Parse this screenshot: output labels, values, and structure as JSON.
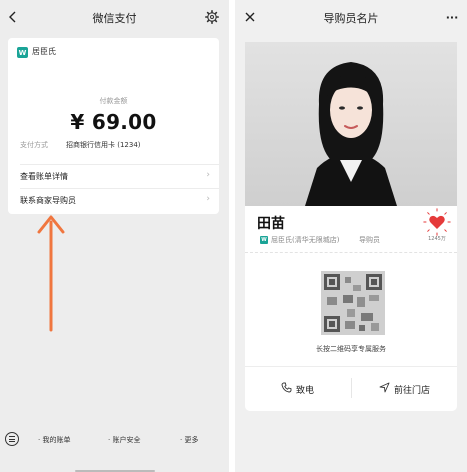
{
  "left": {
    "title": "微信支付",
    "merchant": "居臣氏",
    "logo_text": "W",
    "amount_label": "付款金额",
    "amount": "¥ 69.00",
    "payment_method_label": "支付方式",
    "payment_method_value": "招商银行信用卡 (1234)",
    "rows": [
      {
        "label": "查看账单详情"
      },
      {
        "label": "联系商家导购员"
      }
    ],
    "bottom_bar": [
      {
        "label": "· 我的账单"
      },
      {
        "label": "· 账户安全"
      },
      {
        "label": "· 更多"
      }
    ],
    "arrow_color": "#f0763f"
  },
  "right": {
    "title": "导购员名片",
    "more_label": "···",
    "guide_name": "田苗",
    "store": "屈臣氏(清华无限城店)",
    "role": "导购员",
    "likes": "1245万",
    "qr_hint": "长按二维码享专属服务",
    "actions": [
      {
        "label": "致电",
        "icon": "phone-icon"
      },
      {
        "label": "前往门店",
        "icon": "navigate-icon"
      }
    ],
    "brand_color": "#1aa497",
    "like_color": "#e53a3a"
  }
}
